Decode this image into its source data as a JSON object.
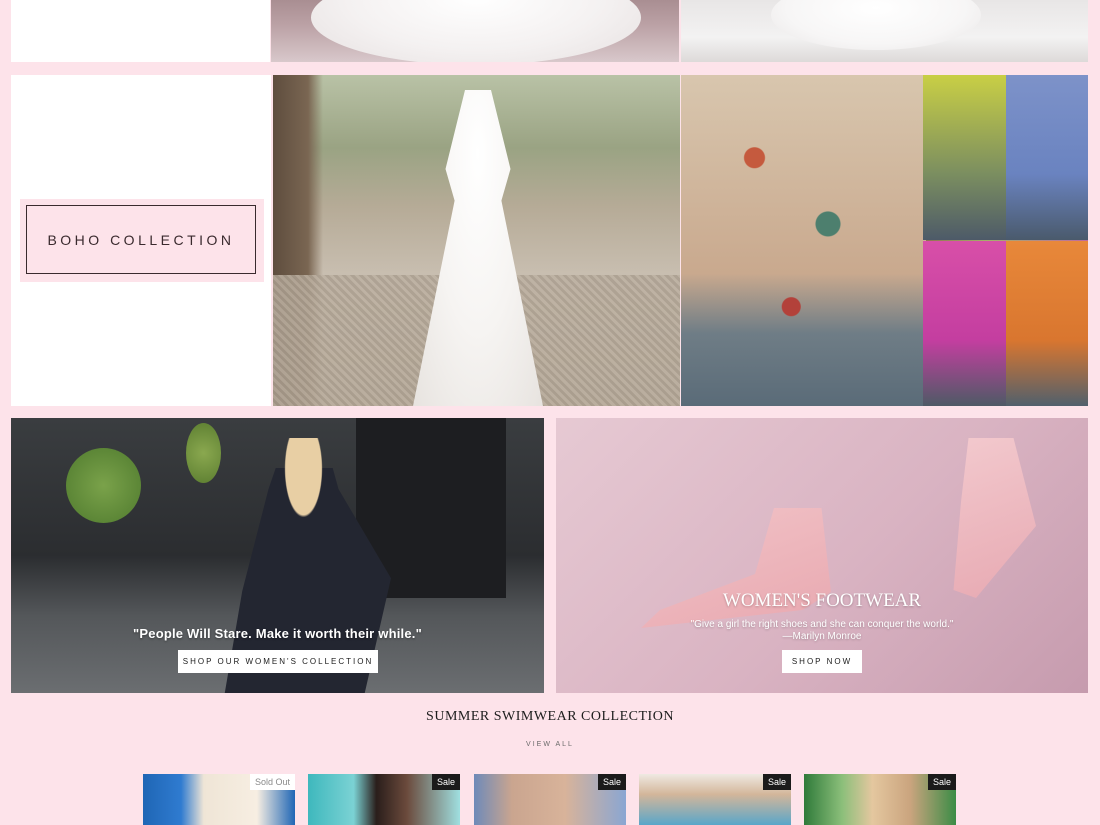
{
  "boho": {
    "button_label": "BOHO COLLECTION"
  },
  "promo_left": {
    "quote": "\"People Will Stare. Make it worth their while.\"",
    "button_label": "SHOP OUR WOMEN'S COLLECTION"
  },
  "promo_right": {
    "title": "WOMEN'S FOOTWEAR",
    "quote_line1": "\"Give a girl the right shoes and she can conquer the world.\"",
    "quote_line2": "—Marilyn Monroe",
    "button_label": "SHOP NOW"
  },
  "swimwear": {
    "title": "SUMMER SWIMWEAR COLLECTION",
    "view_all": "VIEW ALL",
    "products": [
      {
        "badge": "Sold Out"
      },
      {
        "badge": "Sale"
      },
      {
        "badge": "Sale"
      },
      {
        "badge": "Sale"
      },
      {
        "badge": "Sale"
      }
    ]
  },
  "colors": {
    "page_background": "#fde3ea",
    "badge_background": "#1b1b1b",
    "button_background": "#ffffff"
  }
}
